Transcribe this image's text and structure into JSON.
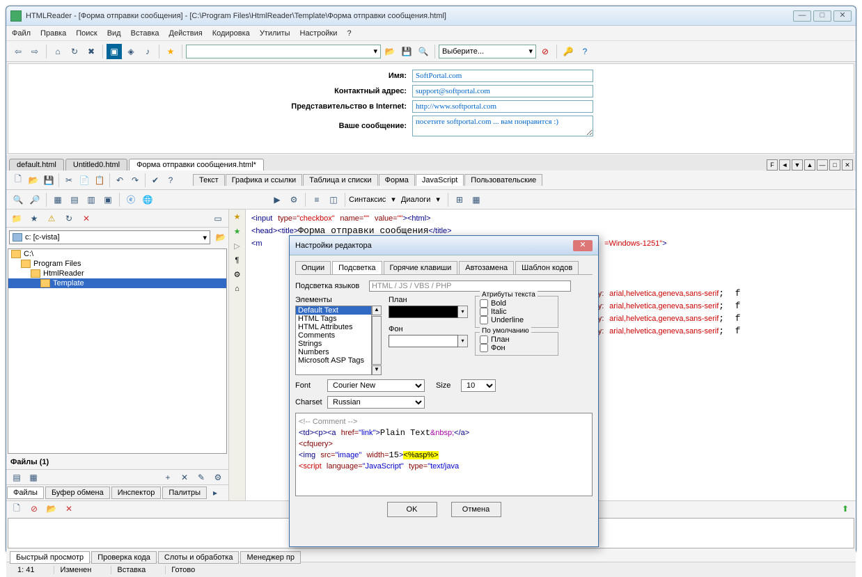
{
  "window": {
    "title": "HTMLReader - [Форма отправки сообщения] - [C:\\Program Files\\HtmlReader\\Template\\Форма отправки сообщения.html]"
  },
  "menu": [
    "Файл",
    "Правка",
    "Поиск",
    "Вид",
    "Вставка",
    "Действия",
    "Кодировка",
    "Утилиты",
    "Настройки",
    "?"
  ],
  "toolbar_combo": "Выберите...",
  "preview_form": {
    "name_label": "Имя:",
    "name_value": "SoftPortal.com",
    "contact_label": "Контактный адрес:",
    "contact_value": "support@softportal.com",
    "internet_label": "Представительство в Internet:",
    "internet_value": "http://www.softportal.com",
    "msg_label": "Ваше сообщение:",
    "msg_value": "посетите softportal.com ... вам понравится :)"
  },
  "doc_tabs": [
    "default.html",
    "Untitled0.html",
    "Форма отправки сообщения.html*"
  ],
  "right_mini": [
    "F",
    "◄",
    "▼",
    "▲",
    "—",
    "□",
    "✕"
  ],
  "sub_tabs": [
    "Текст",
    "Графика и ссылки",
    "Таблица и списки",
    "Форма",
    "JavaScript",
    "Пользовательские"
  ],
  "toolbar3_labels": {
    "syntax": "Синтаксис",
    "dialogs": "Диалоги"
  },
  "drive": "c: [c-vista]",
  "tree": [
    "C:\\",
    "Program Files",
    "HtmlReader",
    "Template"
  ],
  "files_label": "Файлы (1)",
  "left_bottom_tabs": [
    "Файлы",
    "Буфер обмена",
    "Инспектор",
    "Палитры"
  ],
  "code_lines": [
    {
      "pre": "<input type=",
      "a": "\"checkbox\"",
      "mid": " name=",
      "b": "\"\"",
      "mid2": " value=",
      "c": "\"\"",
      "end": "><html>"
    },
    {
      "raw": "<head><title>Форма отправки сообщения</title>"
    },
    {
      "raw": "<meta ...  =Windows-1251\">"
    }
  ],
  "css_tail": "mily: arial,helvetica,geneva,sans-serif;  f",
  "bottom_tabs": [
    "Быстрый просмотр",
    "Проверка кода",
    "Слоты и обработка",
    "Менеджер пр"
  ],
  "status": {
    "pos": "1: 41",
    "changed": "Изменен",
    "insert": "Вставка",
    "ready": "Готово"
  },
  "dialog": {
    "title": "Настройки редактора",
    "tabs": [
      "Опции",
      "Подсветка",
      "Горячие клавиши",
      "Автозамена",
      "Шаблон кодов"
    ],
    "lang_label": "Подсветка языков",
    "lang_value": "HTML / JS / VBS / PHP",
    "elements_label": "Элементы",
    "elements": [
      "Default Text",
      "HTML Tags",
      "HTML Attributes",
      "Comments",
      "Strings",
      "Numbers",
      "Microsoft ASP Tags"
    ],
    "plan_label": "План",
    "fon_label": "Фон",
    "attrs_label": "Атрибуты текста",
    "bold": "Bold",
    "italic": "Italic",
    "underline": "Underline",
    "default_label": "По умолчанию",
    "def_plan": "План",
    "def_fon": "Фон",
    "font_label": "Font",
    "font_value": "Courier New",
    "size_label": "Size",
    "size_value": "10",
    "charset_label": "Charset",
    "charset_value": "Russian",
    "ok": "OK",
    "cancel": "Отмена",
    "sample": "<!-- Comment -->\n<td><p><a href=\"link\">Plain Text&nbsp;</a>\n<cfquery>\n<img src=\"image\" width=15><%asp%>\n<script language=\"JavaScript\" type=\"text/java"
  }
}
